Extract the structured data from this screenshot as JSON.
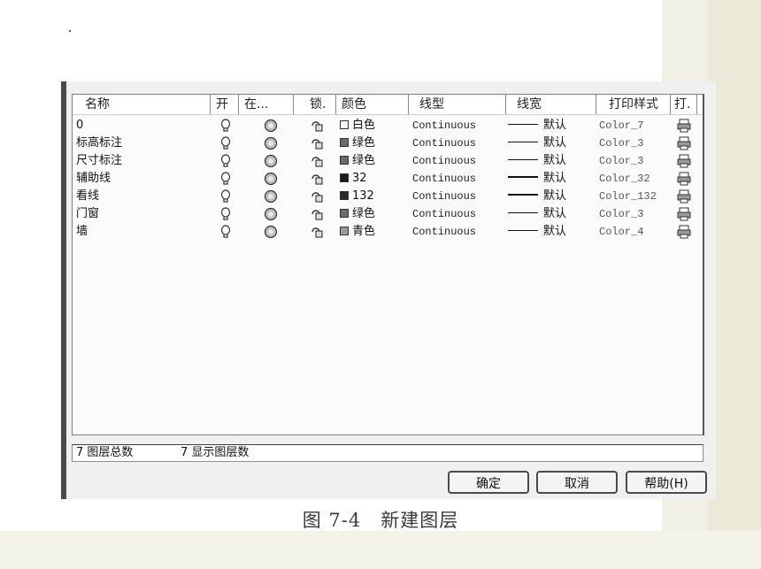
{
  "columns": {
    "name": "名称",
    "on": "开",
    "freeze": "在...",
    "lock": "锁.",
    "color": "颜色",
    "linetype": "线型",
    "lineweight": "线宽",
    "plotstyle": "打印样式",
    "plot": "打."
  },
  "layers": [
    {
      "name": "0",
      "color_name": "白色",
      "swatch": "#ffffff",
      "linetype": "Continuous",
      "lineweight": "默认",
      "plotstyle": "Color_7"
    },
    {
      "name": "标高标注",
      "color_name": "绿色",
      "swatch": "#6a6a6a",
      "linetype": "Continuous",
      "lineweight": "默认",
      "plotstyle": "Color_3"
    },
    {
      "name": "尺寸标注",
      "color_name": "绿色",
      "swatch": "#6a6a6a",
      "linetype": "Continuous",
      "lineweight": "默认",
      "plotstyle": "Color_3"
    },
    {
      "name": "辅助线",
      "color_name": "32",
      "swatch": "#1a1a1a",
      "linetype": "Continuous",
      "lineweight": "默认",
      "plotstyle": "Color_32"
    },
    {
      "name": "看线",
      "color_name": "132",
      "swatch": "#2a2a2a",
      "linetype": "Continuous",
      "lineweight": "默认",
      "plotstyle": "Color_132"
    },
    {
      "name": "门窗",
      "color_name": "绿色",
      "swatch": "#6a6a6a",
      "linetype": "Continuous",
      "lineweight": "默认",
      "plotstyle": "Color_3"
    },
    {
      "name": "墙",
      "color_name": "青色",
      "swatch": "#9a9a9a",
      "linetype": "Continuous",
      "lineweight": "默认",
      "plotstyle": "Color_4"
    }
  ],
  "status": {
    "total": "7 图层总数",
    "shown": "7 显示图层数"
  },
  "buttons": {
    "ok": "确定",
    "cancel": "取消",
    "help": "帮助(H)"
  },
  "caption": "图 7-4　新建图层",
  "icons": {
    "on": "lightbulb-icon",
    "freeze": "sun-circle-icon",
    "lock": "padlock-icon",
    "plot": "printer-icon"
  }
}
